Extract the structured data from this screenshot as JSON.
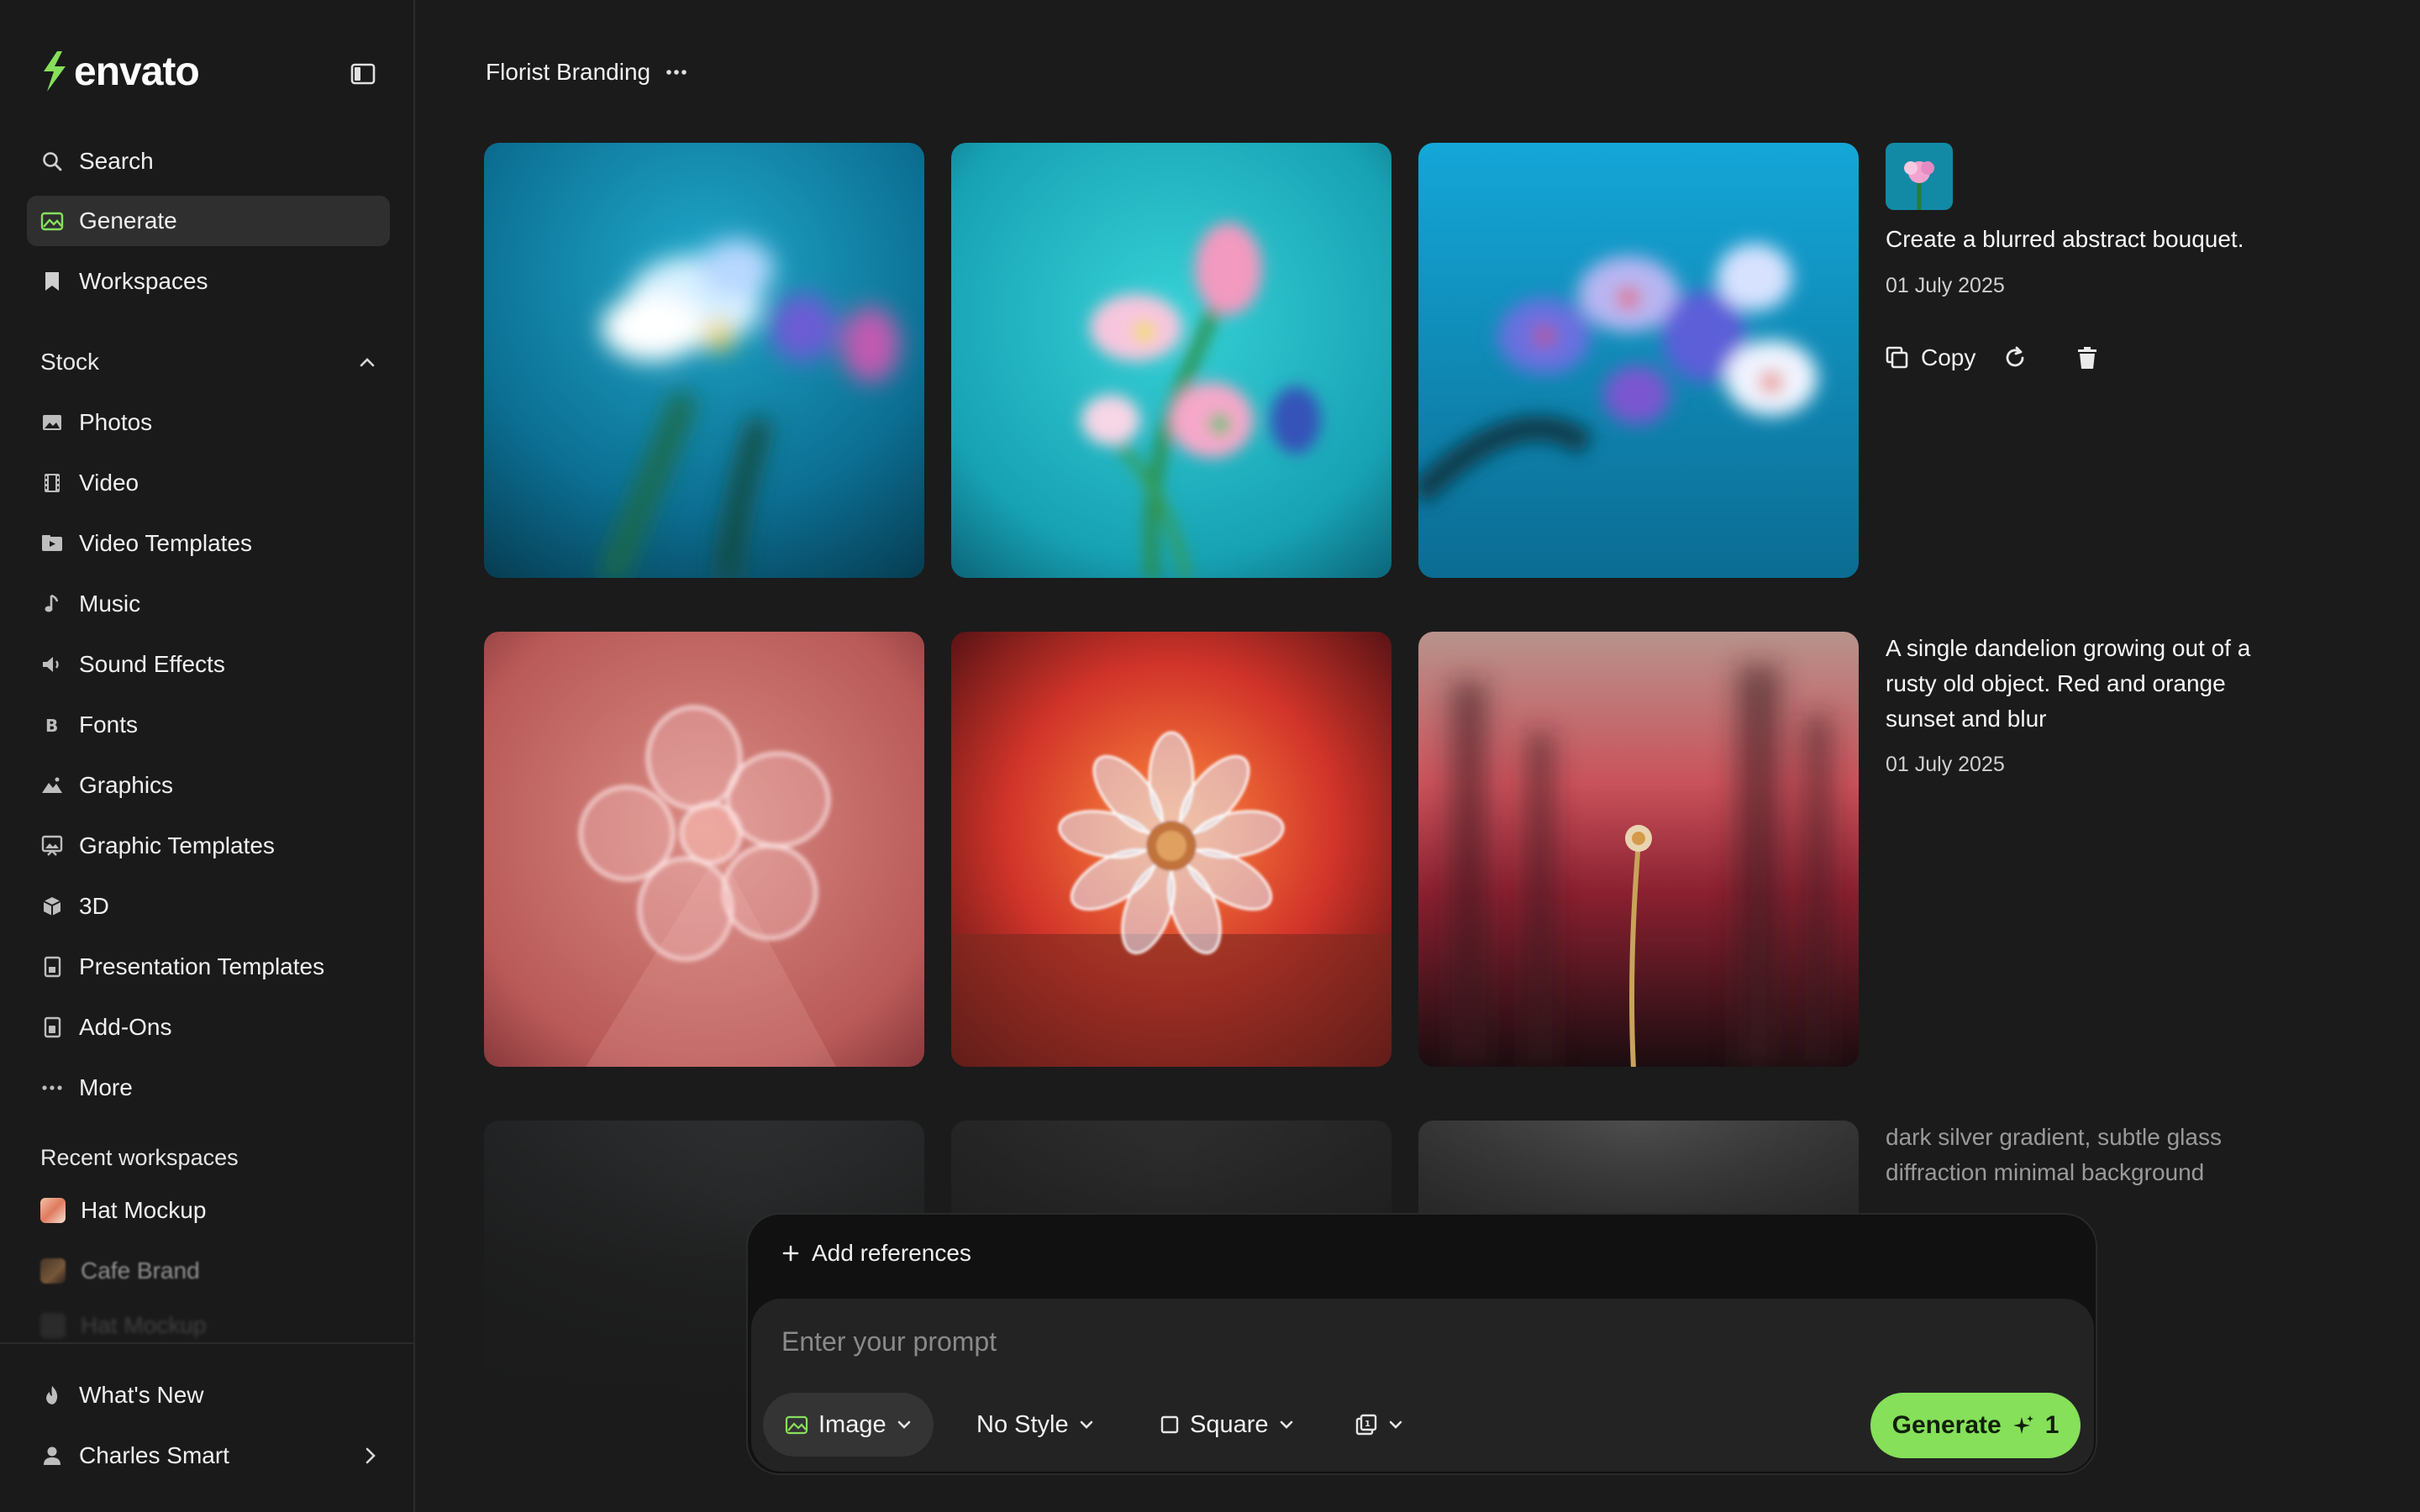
{
  "app": {
    "logo_text": "envato",
    "brand_color": "#86e05a"
  },
  "sidebar": {
    "top_items": [
      {
        "label": "Search",
        "icon": "search-icon"
      },
      {
        "label": "Generate",
        "icon": "generate-icon",
        "active": true
      },
      {
        "label": "Workspaces",
        "icon": "bookmark-icon"
      }
    ],
    "stock_section": {
      "title": "Stock",
      "expanded": true,
      "items": [
        {
          "label": "Photos",
          "icon": "photo-icon"
        },
        {
          "label": "Video",
          "icon": "film-icon"
        },
        {
          "label": "Video Templates",
          "icon": "video-template-icon"
        },
        {
          "label": "Music",
          "icon": "music-note-icon"
        },
        {
          "label": "Sound Effects",
          "icon": "speaker-icon"
        },
        {
          "label": "Fonts",
          "icon": "font-icon"
        },
        {
          "label": "Graphics",
          "icon": "graphics-icon"
        },
        {
          "label": "Graphic Templates",
          "icon": "graphic-template-icon"
        },
        {
          "label": "3D",
          "icon": "cube-icon"
        },
        {
          "label": "Presentation Templates",
          "icon": "presentation-icon"
        },
        {
          "label": "Add-Ons",
          "icon": "addon-icon"
        },
        {
          "label": "More",
          "icon": "more-dots-icon"
        }
      ]
    },
    "recent_workspaces": {
      "title": "Recent workspaces",
      "items": [
        {
          "label": "Hat Mockup"
        },
        {
          "label": "Cafe Brand"
        },
        {
          "label": "Hat Mockup"
        }
      ]
    },
    "footer": {
      "whats_new": "What's New",
      "user_name": "Charles Smart"
    }
  },
  "main": {
    "workspace_title": "Florist Branding",
    "generations": [
      {
        "prompt": "Create a blurred abstract bouquet.",
        "date": "01 July 2025",
        "actions": {
          "copy_label": "Copy"
        }
      },
      {
        "prompt": "A single dandelion growing out of a rusty old object. Red and orange sunset and blur",
        "date": "01 July 2025"
      },
      {
        "prompt": "dark silver gradient, subtle glass diffraction minimal background"
      }
    ]
  },
  "prompt_panel": {
    "add_references_label": "Add references",
    "prompt_placeholder": "Enter your prompt",
    "prompt_value": "",
    "type_label": "Image",
    "style_label": "No Style",
    "aspect_label": "Square",
    "generate_label": "Generate",
    "generate_cost": "1"
  }
}
